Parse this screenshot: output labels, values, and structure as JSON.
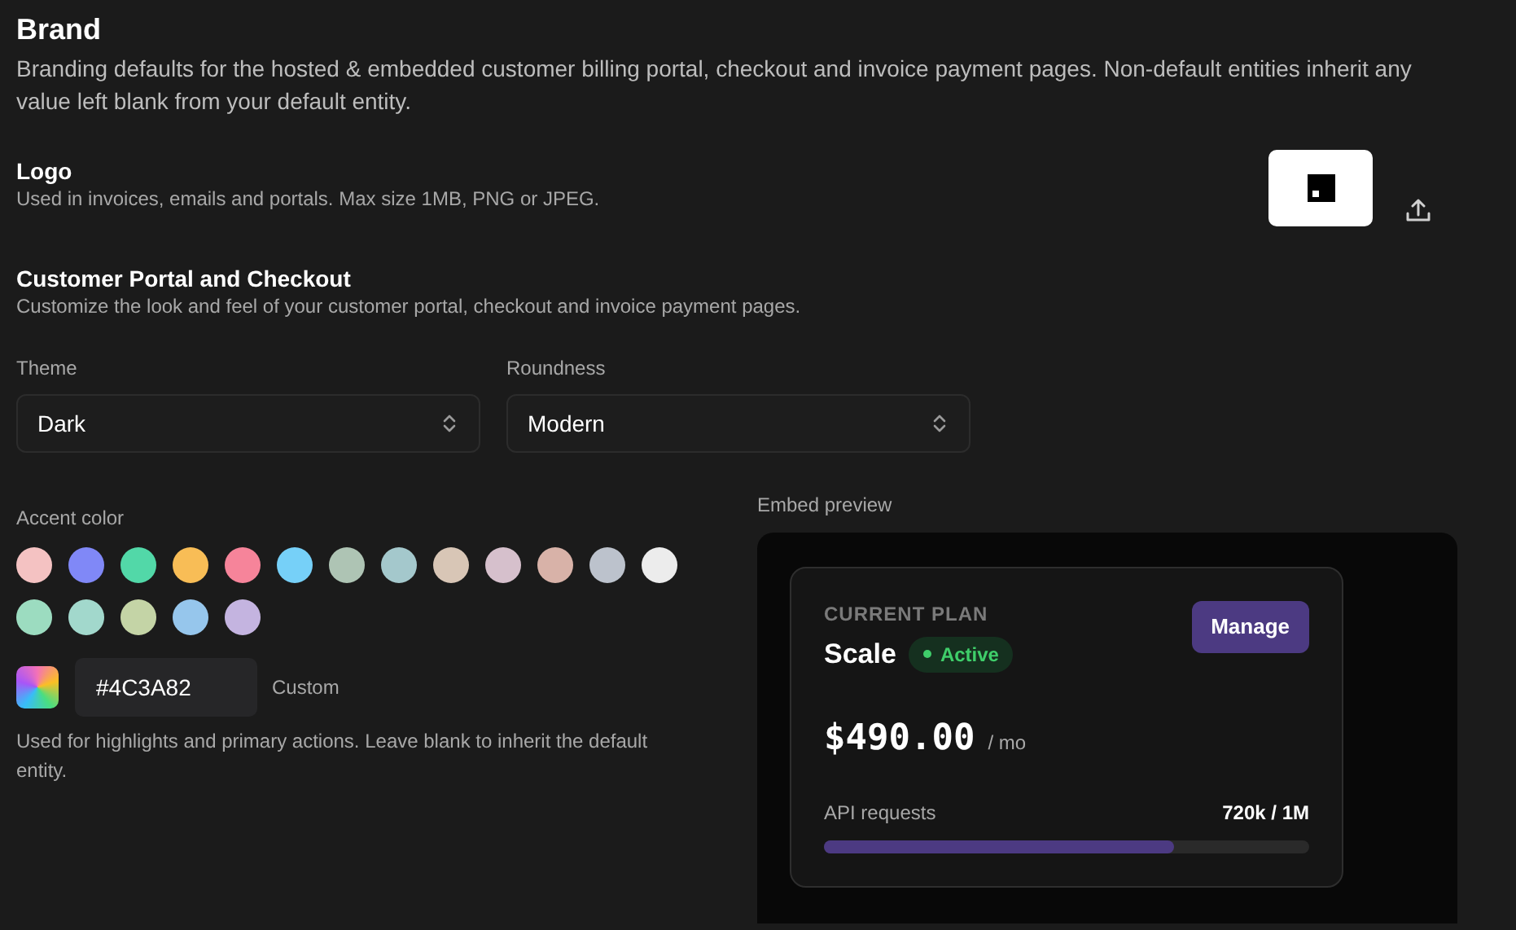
{
  "brand": {
    "title": "Brand",
    "description": "Branding defaults for the hosted & embedded customer billing portal, checkout and invoice payment pages. Non-default entities inherit any value left blank from your default entity."
  },
  "logo": {
    "title": "Logo",
    "description": "Used in invoices, emails and portals. Max size 1MB, PNG or JPEG."
  },
  "portal": {
    "title": "Customer Portal and Checkout",
    "description": "Customize the look and feel of your customer portal, checkout and invoice payment pages."
  },
  "selects": [
    {
      "label": "Theme",
      "value": "Dark"
    },
    {
      "label": "Roundness",
      "value": "Modern"
    }
  ],
  "accent": {
    "label": "Accent color",
    "swatches": [
      {
        "color": "#f4c2c2"
      },
      {
        "color": "#8088f7"
      },
      {
        "color": "#52d8a8"
      },
      {
        "color": "#f8bd56"
      },
      {
        "color": "#f6849a"
      },
      {
        "color": "#76d0f8"
      },
      {
        "color": "#aec4b4"
      },
      {
        "color": "#a4c8cc"
      },
      {
        "color": "#d8c6b6"
      },
      {
        "color": "#d6c0cc"
      },
      {
        "color": "#d8b2a8"
      },
      {
        "color": "#bcc2cc"
      },
      {
        "color": "#ececec"
      },
      {
        "color": "#9cdcc0"
      },
      {
        "color": "#a2d8cc"
      },
      {
        "color": "#c4d4a6"
      },
      {
        "color": "#96c6ec"
      },
      {
        "color": "#c4b4e0"
      }
    ],
    "value": "#4C3A82",
    "custom_label": "Custom",
    "hint": "Used for highlights and primary actions. Leave blank to inherit the default entity."
  },
  "preview": {
    "label": "Embed preview",
    "plan_label": "CURRENT PLAN",
    "plan": "Scale",
    "status": "Active",
    "button": "Manage",
    "price": "$490.00",
    "period": "/ mo",
    "usage_label": "API requests",
    "usage_value": "720k / 1M",
    "level": 0.72
  }
}
